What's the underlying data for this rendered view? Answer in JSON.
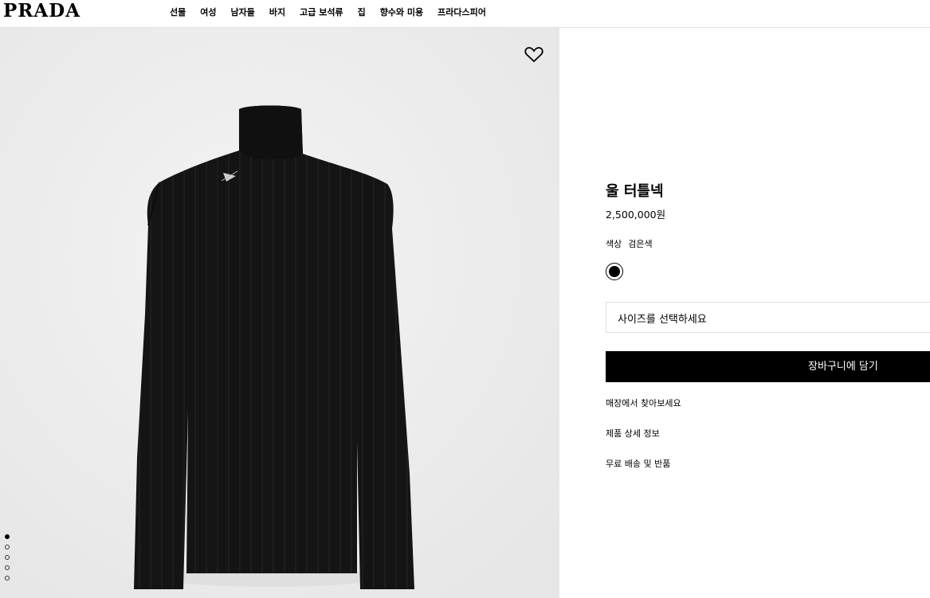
{
  "header": {
    "logo": "PRADA",
    "nav": [
      "선물",
      "여성",
      "남자들",
      "바지",
      "고급 보석류",
      "집",
      "향수와 미용",
      "프라다스피어"
    ]
  },
  "product": {
    "title": "울 터틀넥",
    "price": "2,500,000원",
    "color_label": "색상",
    "color_value": "검은색",
    "swatch_color": "#000000",
    "size_placeholder": "사이즈를 선택하세요",
    "add_to_cart": "장바구니에 담기",
    "links": [
      "매장에서 찾아보세요",
      "제품 상세 정보",
      "무료 배송 및 반품"
    ]
  },
  "gallery": {
    "background": "#eeeeee",
    "image_count": 5,
    "active_index": 0,
    "wishlist_icon": "heart-outline-icon"
  }
}
